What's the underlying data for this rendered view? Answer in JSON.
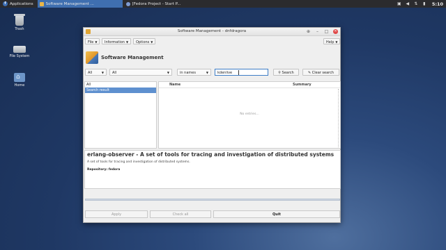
{
  "panel": {
    "apps_label": "Applications",
    "tasks": [
      {
        "label": "Software Management ...",
        "active": true
      },
      {
        "label": "[Fedora Project - Start P...",
        "active": false
      }
    ],
    "clock": "5:10"
  },
  "desktop": {
    "icons": [
      {
        "label": "Trash"
      },
      {
        "label": "File System"
      },
      {
        "label": "Home"
      }
    ]
  },
  "window": {
    "title": "Software Management - dnfdragora",
    "menus": {
      "file": "File",
      "information": "Information",
      "options": "Options",
      "help": "Help"
    },
    "header_title": "Software Management",
    "filters": {
      "view": "All",
      "status": "All",
      "field": "in names",
      "search_value": "kdenlive",
      "search_button": "Search",
      "clear_button": "Clear search"
    },
    "groups": [
      "All",
      "Search result"
    ],
    "list_headers": {
      "name": "Name",
      "summary": "Summary"
    },
    "empty_text": "No entries...",
    "detail": {
      "title": "erlang-observer - A set of tools for tracing and investigation of distributed systems",
      "description": "A set of tools for tracing and investigation of distributed systems.",
      "repo_label": "Repository:",
      "repo_value": "fedora"
    },
    "buttons": {
      "apply": "Apply",
      "check_all": "Check all",
      "quit": "Quit"
    }
  }
}
